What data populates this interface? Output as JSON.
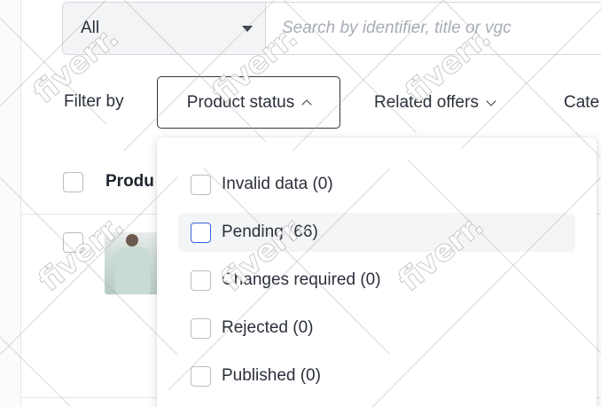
{
  "search": {
    "scope_value": "All",
    "placeholder": "Search by identifier, title or vgc"
  },
  "filters": {
    "label": "Filter by",
    "product_status": "Product status",
    "related_offers": "Related offers",
    "category_partial": "Cate"
  },
  "table": {
    "header_label_partial": "Produ"
  },
  "status_dropdown": {
    "items": [
      {
        "label": "Invalid data (0)"
      },
      {
        "label": "Pending (66)"
      },
      {
        "label": "Changes required (0)"
      },
      {
        "label": "Rejected (0)"
      },
      {
        "label": "Published (0)"
      }
    ],
    "hovered_index": 1
  },
  "watermark": {
    "text": "fiverr."
  },
  "colors": {
    "accent": "#3a63d8",
    "border": "#d5d8de",
    "text": "#2a2f3a"
  },
  "icons": [
    "chevron-down-icon",
    "chevron-up-icon",
    "caret-down-icon",
    "checkbox"
  ]
}
